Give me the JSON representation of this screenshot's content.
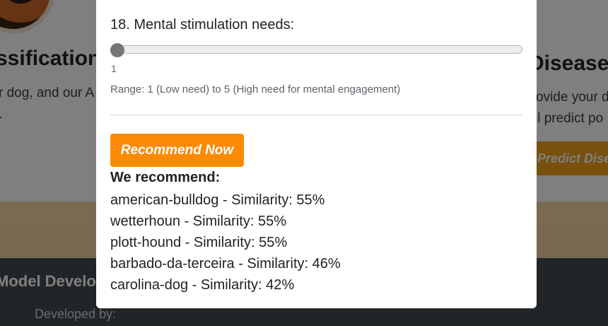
{
  "background": {
    "left_card": {
      "title": "ssification",
      "text_line_1": "r dog, and our A",
      "text_line_2": "l."
    },
    "right_card": {
      "title": "Disease P",
      "text_line_1": "ovide your d",
      "text_line_2": "ll predict po",
      "button_label": "Predict Dise"
    },
    "footer": {
      "heading": "Model Develop",
      "developed_by": "Developed by:"
    }
  },
  "modal": {
    "question_label": "18. Mental stimulation needs:",
    "slider": {
      "value": "1",
      "min": 1,
      "max": 5
    },
    "range_hint": "Range: 1 (Low need) to 5 (High need for mental engagement)",
    "recommend_button": "Recommend Now",
    "results_heading": "We recommend:",
    "results": [
      "american-bulldog - Similarity: 55%",
      "wetterhoun - Similarity: 55%",
      "plott-hound - Similarity: 55%",
      "barbado-da-terceira - Similarity: 46%",
      "carolina-dog - Similarity: 42%"
    ]
  },
  "colors": {
    "accent_button": "#fd8a05",
    "background_button": "#f2a01c",
    "footer_bg": "#444a50"
  }
}
